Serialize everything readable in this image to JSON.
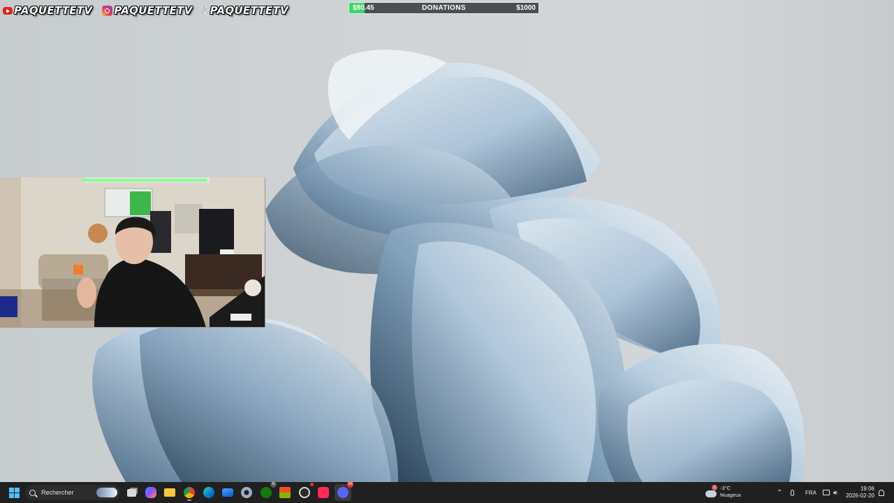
{
  "overlay": {
    "socials": [
      {
        "platform": "youtube",
        "icon": "youtube-icon",
        "handle": "PAQUETTETV"
      },
      {
        "platform": "instagram",
        "icon": "instagram-icon",
        "handle": "PAQUETTETV"
      },
      {
        "platform": "tiktok",
        "icon": "tiktok-icon",
        "handle": "PAQUETTETV"
      }
    ],
    "donation": {
      "current": "$80.45",
      "title": "DONATIONS",
      "goal": "$1000",
      "progress_fraction": 0.08,
      "fill_color": "#3ed66b"
    }
  },
  "taskbar": {
    "search_placeholder": "Rechercher",
    "apps": [
      {
        "name": "task-view",
        "icon": "task-view-icon"
      },
      {
        "name": "copilot",
        "icon": "copilot-icon"
      },
      {
        "name": "file-explorer",
        "icon": "folder-icon"
      },
      {
        "name": "chrome",
        "icon": "chrome-icon"
      },
      {
        "name": "edge",
        "icon": "edge-icon"
      },
      {
        "name": "mail",
        "icon": "mail-icon"
      },
      {
        "name": "settings",
        "icon": "gear-icon"
      },
      {
        "name": "xbox",
        "icon": "xbox-icon",
        "badge": "8"
      },
      {
        "name": "store",
        "icon": "store-icon"
      },
      {
        "name": "obs",
        "icon": "obs-icon"
      },
      {
        "name": "tiktok-live",
        "icon": "tiktok-icon"
      },
      {
        "name": "discord",
        "icon": "discord-icon",
        "badge": "38"
      }
    ],
    "weather": {
      "temp": "-3°C",
      "condition": "Nuageux",
      "badge": "1"
    },
    "language": "FRA",
    "time": "19:06",
    "date": "2026-02-20"
  },
  "colors": {
    "taskbar_bg": "#202020",
    "accent": "#4cc2ff",
    "donation_bg": "#4a4f52"
  }
}
